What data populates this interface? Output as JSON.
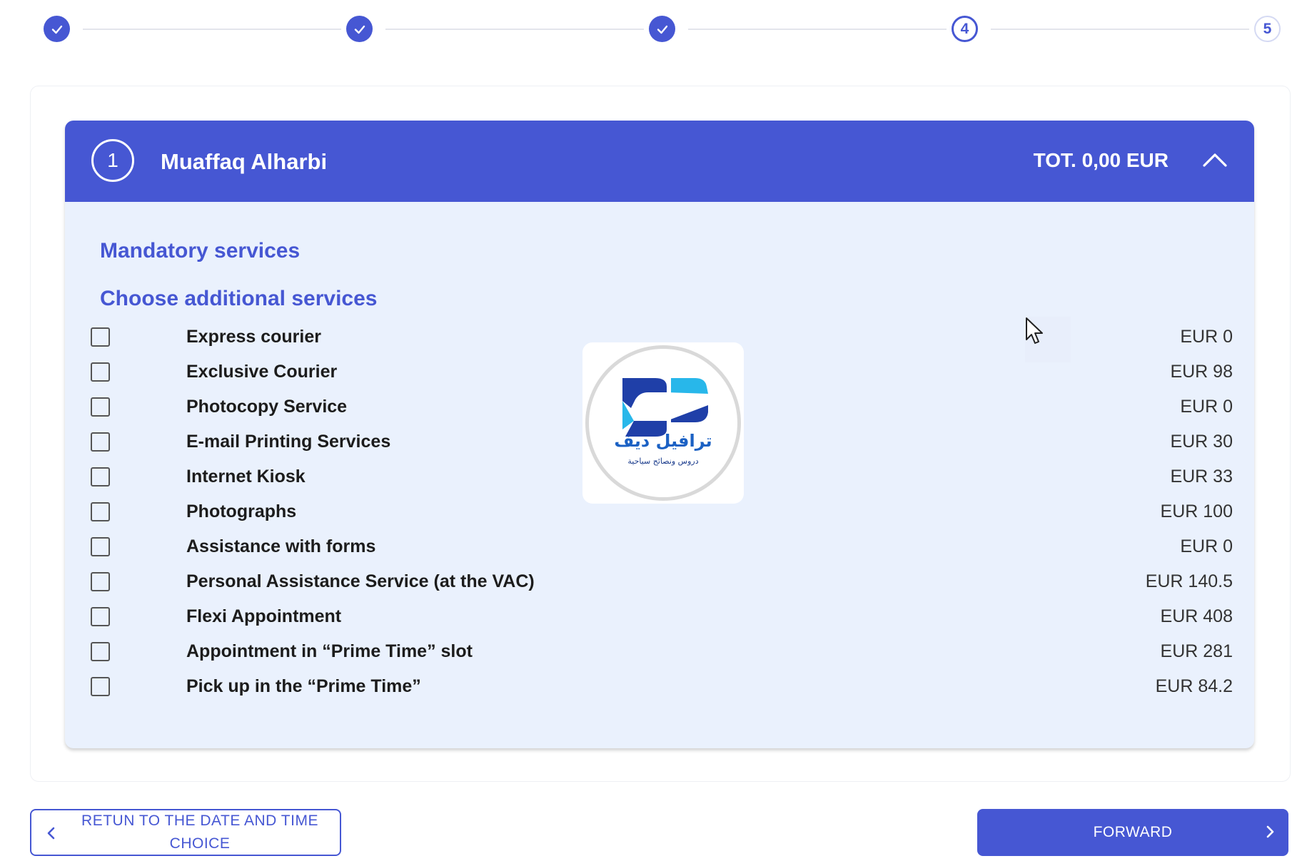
{
  "stepper": {
    "steps": [
      {
        "label": "",
        "status": "done"
      },
      {
        "label": "",
        "status": "done"
      },
      {
        "label": "",
        "status": "done"
      },
      {
        "label": "4",
        "status": "current"
      },
      {
        "label": "5",
        "status": "upcoming"
      }
    ]
  },
  "applicant": {
    "number": "1",
    "name": "Muaffaq Alharbi",
    "total": "TOT. 0,00 EUR"
  },
  "sections": {
    "mandatory_title": "Mandatory services",
    "additional_title": "Choose additional services"
  },
  "services": [
    {
      "name": "Express courier",
      "price": "EUR 0",
      "checked": false
    },
    {
      "name": "Exclusive Courier",
      "price": "EUR 98",
      "checked": false
    },
    {
      "name": "Photocopy Service",
      "price": "EUR 0",
      "checked": false
    },
    {
      "name": "E-mail Printing Services",
      "price": "EUR 30",
      "checked": false
    },
    {
      "name": "Internet Kiosk",
      "price": "EUR 33",
      "checked": false
    },
    {
      "name": "Photographs",
      "price": "EUR 100",
      "checked": false
    },
    {
      "name": "Assistance with forms",
      "price": "EUR 0",
      "checked": false
    },
    {
      "name": "Personal Assistance Service (at the VAC)",
      "price": "EUR 140.5",
      "checked": false
    },
    {
      "name": "Flexi Appointment",
      "price": "EUR 408",
      "checked": false
    },
    {
      "name": "Appointment in “Prime Time” slot",
      "price": "EUR 281",
      "checked": false
    },
    {
      "name": "Pick up in the “Prime Time”",
      "price": "EUR 84.2",
      "checked": false
    }
  ],
  "watermark": {
    "title": "ترافيل ديف",
    "subtitle": "دروس ونصائح سياحية"
  },
  "buttons": {
    "back_label": "RETUN TO THE DATE AND TIME CHOICE",
    "forward_label": "FORWARD"
  },
  "colors": {
    "primary": "#4657d3",
    "panel_bg": "#eaf1fd",
    "text": "#1c1c1c"
  },
  "icons": {
    "step_done": "check-icon",
    "collapse": "chevron-up-icon",
    "back": "chevron-left-icon",
    "forward": "chevron-right-icon"
  }
}
